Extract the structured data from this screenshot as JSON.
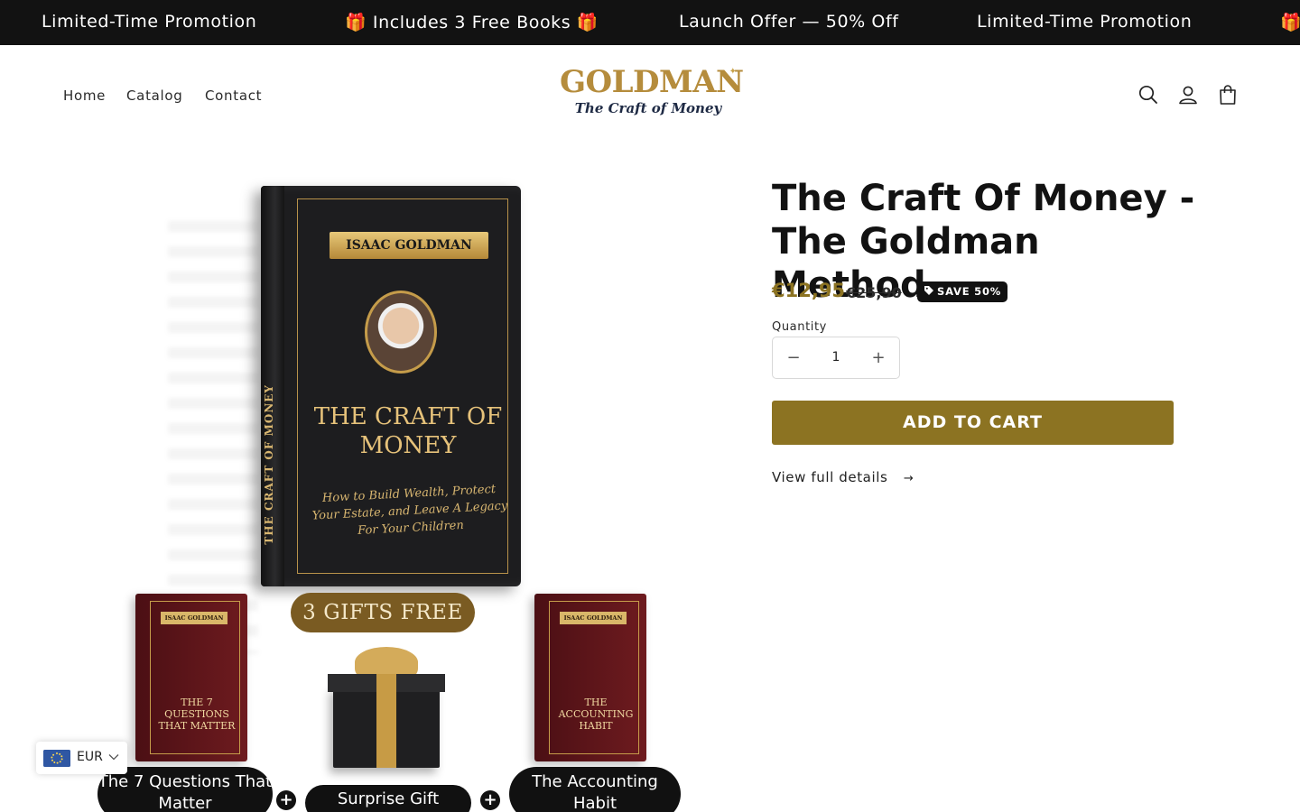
{
  "announcement": {
    "items": [
      "Limited-Time Promotion",
      "🎁 Includes 3 Free Books 🎁",
      "Launch Offer — 50% Off",
      "Limited-Time Promotion",
      "🎁"
    ]
  },
  "nav": {
    "items": [
      {
        "label": "Home"
      },
      {
        "label": "Catalog"
      },
      {
        "label": "Contact"
      }
    ]
  },
  "logo": {
    "brand": "GOLDMAN",
    "tagline": "The Craft of Money"
  },
  "header_icons": [
    "search-icon",
    "account-icon",
    "cart-icon"
  ],
  "product": {
    "title": "The Craft Of Money - The Goldman Method",
    "price": "€12,95",
    "compare_price": "€25,90",
    "badge": "SAVE 50%",
    "quantity_label": "Quantity",
    "quantity": "1",
    "decrease_symbol": "−",
    "increase_symbol": "+",
    "add_to_cart": "ADD TO CART",
    "view_details": "View full details",
    "arrow": "→"
  },
  "media": {
    "book_author": "ISAAC GOLDMAN",
    "book_title": "THE CRAFT OF MONEY",
    "book_subtitle": "How to Build Wealth, Protect Your Estate, and Leave A Legacy For Your Children",
    "book_spine": "THE CRAFT OF MONEY",
    "gifts_banner": "3 GIFTS FREE",
    "minibook_author": "ISAAC GOLDMAN",
    "minibook_left_title": "THE 7 QUESTIONS THAT MATTER",
    "minibook_right_title": "THE ACCOUNTING HABIT",
    "captions": [
      "The 7 Questions That Matter",
      "Surprise Gift",
      "The Accounting Habit"
    ],
    "plus": "+"
  },
  "currency": {
    "code": "EUR",
    "icons": [
      "eu-flag-icon",
      "chevron-down-icon"
    ]
  },
  "colors": {
    "accent": "#8c7322",
    "dark": "#121212"
  }
}
